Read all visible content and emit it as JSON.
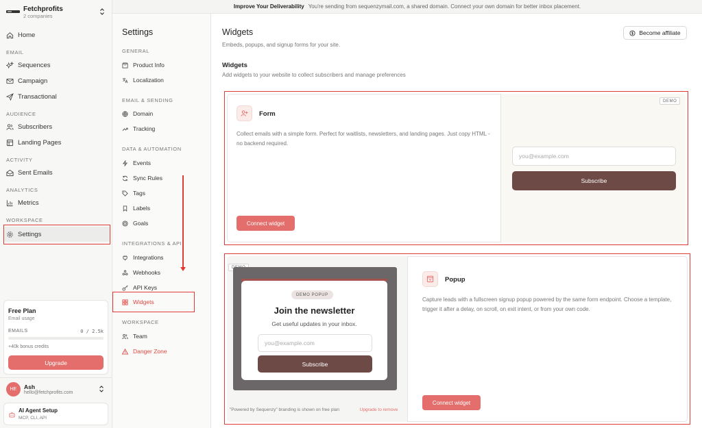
{
  "org": {
    "name": "Fetchprofits",
    "sub": "2 companies"
  },
  "sidebar": {
    "home": "Home",
    "email_section": "EMAIL",
    "sequences": "Sequences",
    "campaign": "Campaign",
    "transactional": "Transactional",
    "audience_section": "AUDIENCE",
    "subscribers": "Subscribers",
    "landing_pages": "Landing Pages",
    "activity_section": "ACTIVITY",
    "sent_emails": "Sent Emails",
    "analytics_section": "ANALYTICS",
    "metrics": "Metrics",
    "workspace_section": "WORKSPACE",
    "settings": "Settings"
  },
  "plan": {
    "title": "Free Plan",
    "sub": "Email usage",
    "emails_label": "EMAILS",
    "count": "0 / 2.5k",
    "usage_fraction": 0,
    "bonus": "+40k bonus credits",
    "upgrade": "Upgrade"
  },
  "user": {
    "initials": "HE",
    "name": "Ash",
    "email": "hello@fetchprofits.com"
  },
  "agent": {
    "title": "AI Agent Setup",
    "sub": "MCP, CLI, API"
  },
  "banner": {
    "title": "Improve Your Deliverability",
    "text": "You're sending from sequenzymail.com, a shared domain. Connect your own domain for better inbox placement."
  },
  "settings_nav": {
    "title": "Settings",
    "general": "GENERAL",
    "product_info": "Product Info",
    "localization": "Localization",
    "email_sending": "EMAIL & SENDING",
    "domain": "Domain",
    "tracking": "Tracking",
    "data_automation": "DATA & AUTOMATION",
    "events": "Events",
    "sync_rules": "Sync Rules",
    "tags": "Tags",
    "labels": "Labels",
    "goals": "Goals",
    "integrations_api": "INTEGRATIONS & API",
    "integrations": "Integrations",
    "webhooks": "Webhooks",
    "api_keys": "API Keys",
    "widgets": "Widgets",
    "workspace": "WORKSPACE",
    "team": "Team",
    "danger_zone": "Danger Zone"
  },
  "main": {
    "title": "Widgets",
    "subtitle": "Embeds, popups, and signup forms for your site.",
    "affiliate": "Become affiliate",
    "section_title": "Widgets",
    "section_sub": "Add widgets to your website to collect subscribers and manage preferences"
  },
  "form_card": {
    "title": "Form",
    "desc": "Collect emails with a simple form. Perfect for waitlists, newsletters, and landing pages. Just copy HTML - no backend required.",
    "connect": "Connect widget",
    "demo": "DEMO",
    "placeholder": "you@example.com",
    "subscribe": "Subscribe"
  },
  "popup_card": {
    "title": "Popup",
    "desc": "Capture leads with a fullscreen signup popup powered by the same form endpoint. Choose a template, trigger it after a delay, on scroll, on exit intent, or from your own code.",
    "connect": "Connect widget",
    "demo": "DEMO",
    "pill": "DEMO POPUP",
    "heading": "Join the newsletter",
    "text": "Get useful updates in your inbox.",
    "placeholder": "you@example.com",
    "subscribe": "Subscribe",
    "branding": "\"Powered by Sequenzy\" branding is shown on free plan",
    "upgrade_link": "Upgrade to remove"
  },
  "colors": {
    "accent": "#e46e6b",
    "highlight": "#e03a36",
    "button_dark": "#6e4a47"
  }
}
